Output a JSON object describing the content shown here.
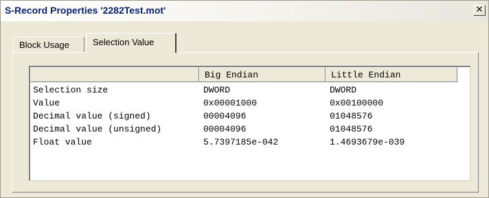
{
  "window": {
    "title": "S-Record Properties '2282Test.mot'",
    "close_label": "✕"
  },
  "tabs": [
    {
      "label": "Block Usage",
      "selected": false
    },
    {
      "label": "Selection Value",
      "selected": true
    }
  ],
  "table": {
    "headers": [
      "",
      "Big Endian",
      "Little Endian"
    ],
    "rows": [
      [
        "Selection size",
        "DWORD",
        "DWORD"
      ],
      [
        "Value",
        "0x00001000",
        "0x00100000"
      ],
      [
        "Decimal value (signed)",
        "00004096",
        "01048576"
      ],
      [
        "Decimal value (unsigned)",
        "00004096",
        "01048576"
      ],
      [
        "Float value",
        "5.7397185e-042",
        "1.4693679e-039"
      ]
    ]
  }
}
